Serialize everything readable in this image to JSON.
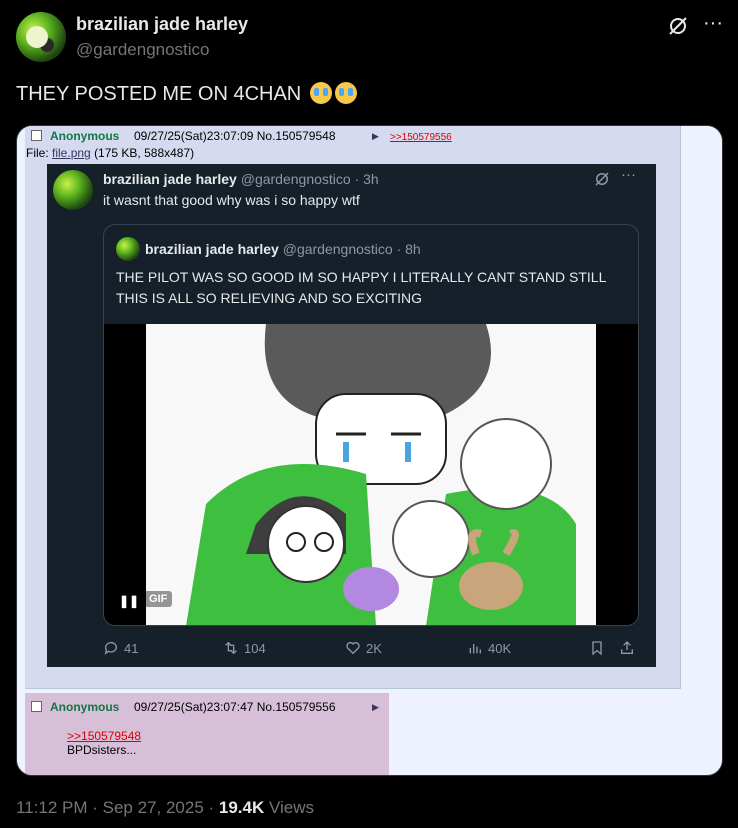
{
  "tweet": {
    "author_name": "brazilian jade harley",
    "author_handle": "@gardengnostico",
    "text": "THEY POSTED ME ON 4CHAN",
    "emoji": "loudly-crying-face x2"
  },
  "chan": {
    "post1": {
      "name": "Anonymous",
      "meta": "09/27/25(Sat)23:07:09 No.150579548",
      "backlink": ">>150579556",
      "file_label": "File:",
      "file_link": "file.png",
      "file_info": "(175 KB, 588x487)"
    },
    "post2": {
      "name": "Anonymous",
      "meta": "09/27/25(Sat)23:07:47 No.150579556",
      "quote_link": ">>150579548",
      "body": "BPDsisters..."
    }
  },
  "screenshot": {
    "name": "brazilian jade harley",
    "handle_time": "@gardengnostico · 3h",
    "text": "it wasnt that good why was i so happy wtf",
    "quote": {
      "name": "brazilian jade harley",
      "handle_time": "@gardengnostico · 8h",
      "text": "THE PILOT WAS SO GOOD IM SO HAPPY I LITERALLY CANT STAND STILL THIS IS ALL SO RELIEVING AND SO EXCITING",
      "gif_label": "GIF"
    },
    "stats": {
      "replies": "41",
      "retweets": "104",
      "likes": "2K",
      "views": "40K"
    }
  },
  "footer": {
    "time": "11:12 PM",
    "date": "Sep 27, 2025",
    "views_count": "19.4K",
    "views_label": "Views"
  }
}
